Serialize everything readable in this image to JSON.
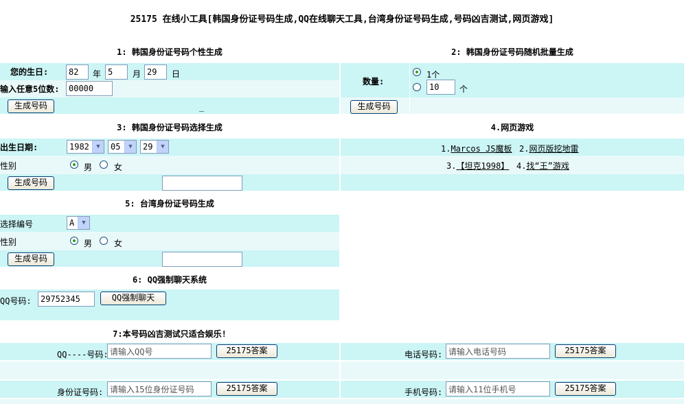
{
  "page_title": "25175 在线小工具[韩国身份证号码生成,QQ在线聊天工具,台湾身份证号码生成,号码凶吉测试,网页游戏]",
  "s1": {
    "title": "1: 韩国身份证号码个性生成",
    "birthday_label": "您的生日:",
    "year": "82",
    "year_unit": "年",
    "month": "5",
    "month_unit": "月",
    "day": "29",
    "day_unit": "日",
    "digits_label": "输入任意5位数:",
    "digits": "00000",
    "button": "生成号码",
    "result": "_"
  },
  "s2": {
    "title": "2: 韩国身份证号码随机批量生成",
    "qty_label": "数量:",
    "opt1": "1个",
    "opt2_value": "10",
    "opt2_unit": "个",
    "button": "生成号码"
  },
  "s3": {
    "title": "3: 韩国身份证号码选择生成",
    "dob_label": "出生日期:",
    "year": "1982",
    "month": "05",
    "day": "29",
    "gender_label": "性别",
    "male": "男",
    "female": "女",
    "button": "生成号码",
    "result": ""
  },
  "s4": {
    "title": "4.网页游戏",
    "games": [
      {
        "num": "1.",
        "name": "Marcos JS魔板"
      },
      {
        "num": "2.",
        "name": "网页版挖地雷"
      },
      {
        "num": "3.",
        "name": "【坦克1998】"
      },
      {
        "num": "4.",
        "name": "找“王”游戏"
      }
    ]
  },
  "s5": {
    "title": "5: 台湾身份证号码生成",
    "code_label": "选择编号",
    "code": "A",
    "gender_label": "性别",
    "male": "男",
    "female": "女",
    "button": "生成号码",
    "result": ""
  },
  "s6": {
    "title": "6: QQ强制聊天系统",
    "qq_label": "QQ号码:",
    "qq": "29752345",
    "button": "QQ强制聊天"
  },
  "s7": {
    "title": "7:本号码凶吉测试只适合娱乐!",
    "qq_label": "QQ----号码:",
    "qq_value": "请输入QQ号",
    "phone_label": "电话号码:",
    "phone_value": "请输入电话号码",
    "id_label": "身份证号码:",
    "id_value": "请输入15位身份证号码",
    "mobile_label": "手机号码:",
    "mobile_value": "请输入11位手机号",
    "answer": "25175答案"
  },
  "colors": {
    "band_dark": "#ccf5f5",
    "band_light": "#e9f9f9",
    "radio_dot": "#21a121"
  }
}
